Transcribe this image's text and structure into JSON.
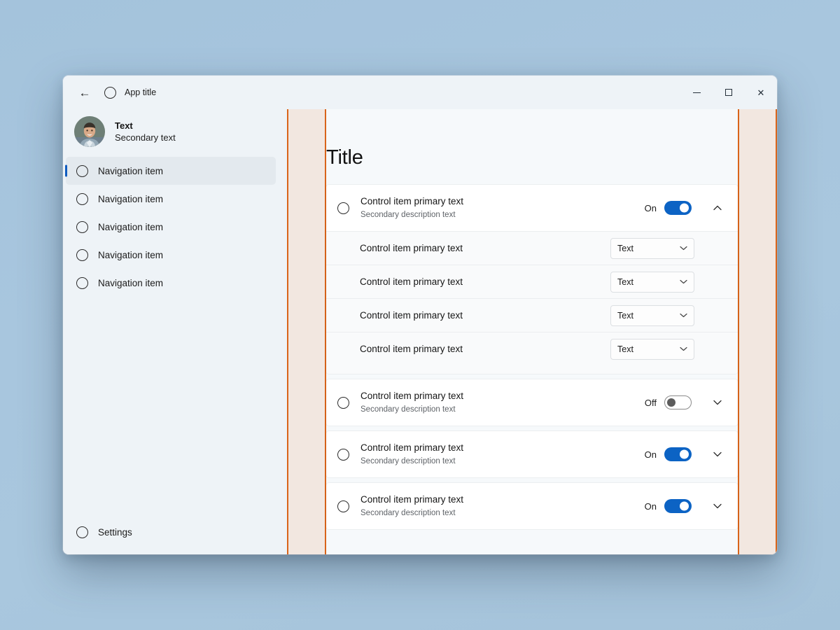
{
  "window": {
    "titlebar": {
      "back_icon": "back-arrow-icon",
      "app_icon": "circle-placeholder-icon",
      "title": "App title",
      "minimize_label": "Minimize",
      "maximize_label": "Maximize",
      "close_label": "Close"
    }
  },
  "sidebar": {
    "profile": {
      "avatar_icon": "user-avatar-photo",
      "primary": "Text",
      "secondary": "Secondary text"
    },
    "items": [
      {
        "label": "Navigation item",
        "icon": "circle-placeholder-icon",
        "selected": true
      },
      {
        "label": "Navigation item",
        "icon": "circle-placeholder-icon",
        "selected": false
      },
      {
        "label": "Navigation item",
        "icon": "circle-placeholder-icon",
        "selected": false
      },
      {
        "label": "Navigation item",
        "icon": "circle-placeholder-icon",
        "selected": false
      },
      {
        "label": "Navigation item",
        "icon": "circle-placeholder-icon",
        "selected": false
      }
    ],
    "settings": {
      "label": "Settings",
      "icon": "circle-placeholder-icon"
    }
  },
  "content": {
    "title": "Title",
    "cards": [
      {
        "icon": "circle-placeholder-icon",
        "primary": "Control item primary text",
        "secondary": "Secondary description text",
        "toggle_label": "On",
        "toggle_state": "on",
        "chevron": "chevron-up-icon",
        "expanded": true,
        "sub_rows": [
          {
            "label": "Control item primary text",
            "select_value": "Text",
            "select_chevron": "chevron-down-icon"
          },
          {
            "label": "Control item primary text",
            "select_value": "Text",
            "select_chevron": "chevron-down-icon"
          },
          {
            "label": "Control item primary text",
            "select_value": "Text",
            "select_chevron": "chevron-down-icon"
          },
          {
            "label": "Control item primary text",
            "select_value": "Text",
            "select_chevron": "chevron-down-icon"
          }
        ]
      },
      {
        "icon": "circle-placeholder-icon",
        "primary": "Control item primary text",
        "secondary": "Secondary description text",
        "toggle_label": "Off",
        "toggle_state": "off",
        "chevron": "chevron-down-icon",
        "expanded": false,
        "sub_rows": []
      },
      {
        "icon": "circle-placeholder-icon",
        "primary": "Control item primary text",
        "secondary": "Secondary description text",
        "toggle_label": "On",
        "toggle_state": "on",
        "chevron": "chevron-down-icon",
        "expanded": false,
        "sub_rows": []
      },
      {
        "icon": "circle-placeholder-icon",
        "primary": "Control item primary text",
        "secondary": "Secondary description text",
        "toggle_label": "On",
        "toggle_state": "on",
        "chevron": "chevron-down-icon",
        "expanded": false,
        "sub_rows": []
      }
    ]
  },
  "colors": {
    "accent": "#0c63c4",
    "nav_indicator": "#0f5bbf",
    "guide_line": "#d9641a",
    "guide_fill": "#f2e7e0",
    "window_chrome": "#eef3f7",
    "content_bg": "#f6f9fb",
    "card_bg": "#ffffff",
    "subrow_bg": "#f9fafb",
    "desktop": "#a7c5dd"
  }
}
